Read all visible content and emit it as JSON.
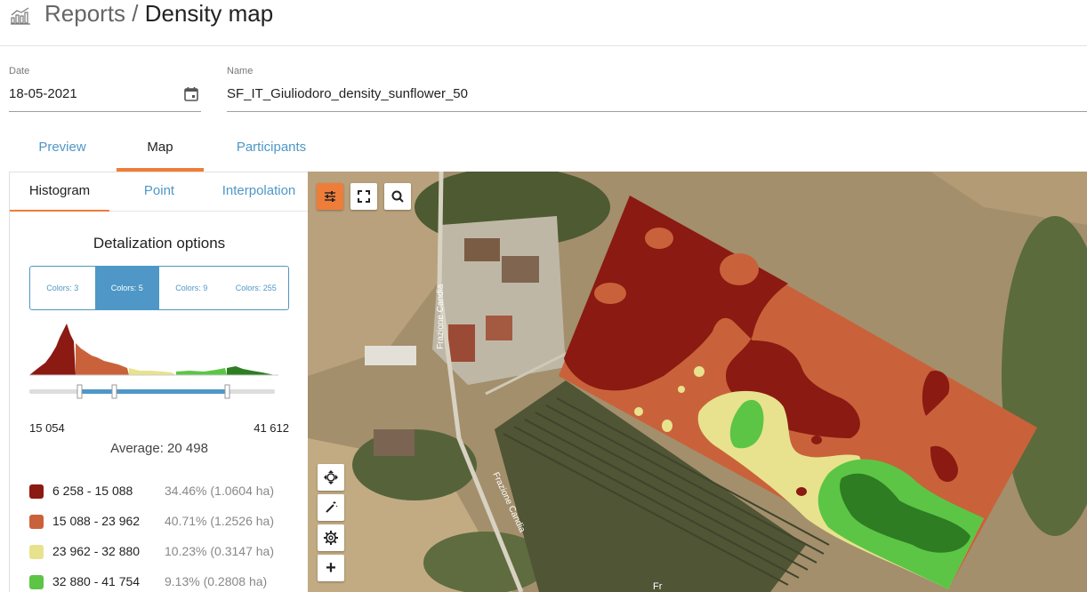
{
  "header": {
    "section": "Reports",
    "separator": " / ",
    "current": "Density map"
  },
  "form": {
    "date_label": "Date",
    "date_value": "18-05-2021",
    "name_label": "Name",
    "name_value": "SF_IT_Giuliodoro_density_sunflower_50"
  },
  "tabs": [
    {
      "label": "Preview",
      "active": false
    },
    {
      "label": "Map",
      "active": true
    },
    {
      "label": "Participants",
      "active": false
    }
  ],
  "subtabs": [
    {
      "label": "Histogram",
      "active": true
    },
    {
      "label": "Point",
      "active": false
    },
    {
      "label": "Interpolation",
      "active": false
    }
  ],
  "detalization": {
    "title": "Detalization options",
    "options": [
      "Colors: 3",
      "Colors: 5",
      "Colors: 9",
      "Colors: 255"
    ],
    "selected": "Colors: 5"
  },
  "histogram": {
    "min": "15 054",
    "max": "41 612",
    "average": "Average: 20 498",
    "slider_low_fraction": 0.2,
    "slider_high_fraction": 0.8
  },
  "legend": [
    {
      "range": "6 258 - 15 088",
      "pct": "34.46% (1.0604 ha)",
      "color": "#8b1a12"
    },
    {
      "range": "15 088 - 23 962",
      "pct": "40.71% (1.2526 ha)",
      "color": "#c9623a"
    },
    {
      "range": "23 962 - 32 880",
      "pct": "10.23% (0.3147 ha)",
      "color": "#e8e28e"
    },
    {
      "range": "32 880 - 41 754",
      "pct": "9.13% (0.2808 ha)",
      "color": "#5cc546"
    }
  ],
  "map": {
    "road_label_1": "Frazione Candia",
    "road_label_2": "Frazione Candia",
    "road_label_3": "Fr"
  },
  "colors": {
    "accent_orange": "#ee7d3a",
    "accent_blue": "#4e97c7"
  }
}
